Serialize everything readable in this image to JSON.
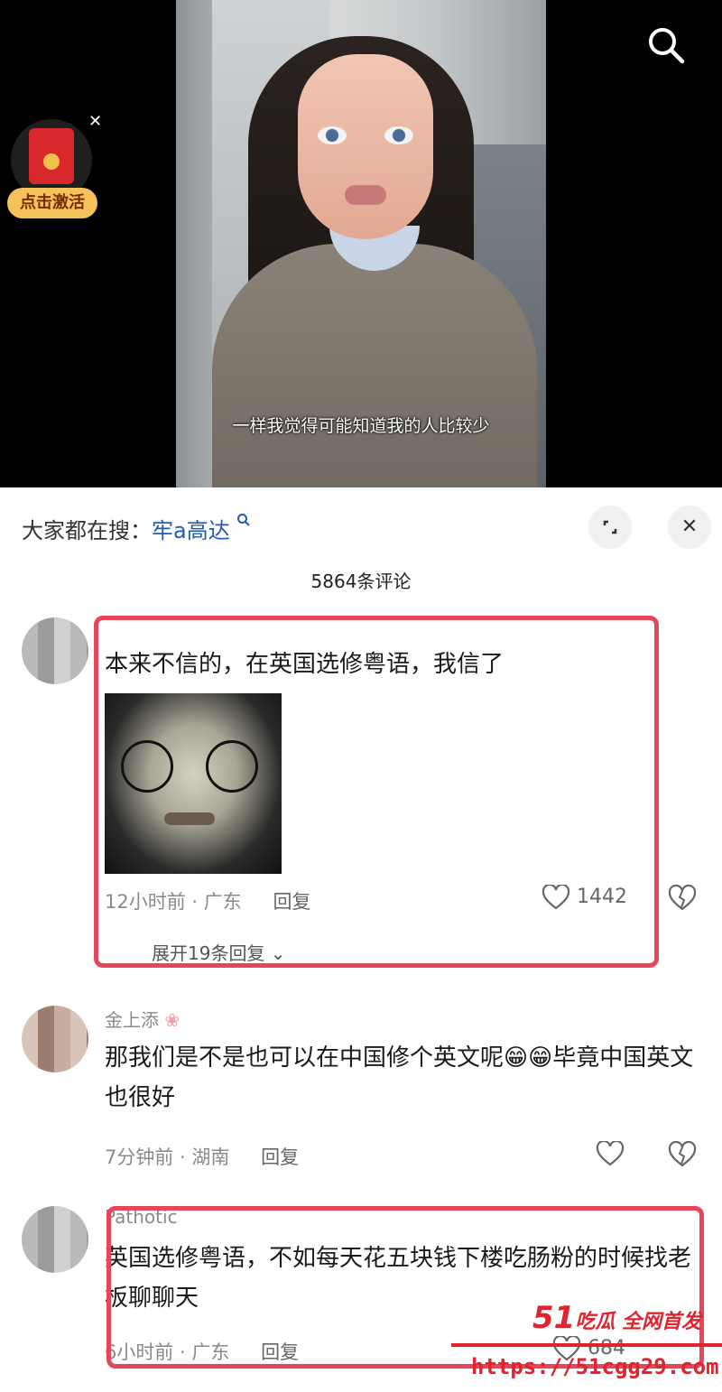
{
  "video": {
    "subtitle": "一样我觉得可能知道我的人比较少",
    "promo_button": "点击激活"
  },
  "panel": {
    "search_prefix": "大家都在搜：",
    "search_keyword": "牢a高达",
    "comment_count": "5864条评论"
  },
  "comments": [
    {
      "username": "",
      "text": "本来不信的，在英国选修粤语，我信了",
      "time": "12小时前",
      "location": "广东",
      "reply_label": "回复",
      "likes": "1442",
      "replies_link": "展开19条回复"
    },
    {
      "username": "金上添",
      "text": "那我们是不是也可以在中国修个英文呢😁😁毕竟中国英文也很好",
      "time": "7分钟前",
      "location": "湖南",
      "reply_label": "回复",
      "likes": ""
    },
    {
      "username": "Pathotic",
      "text": "英国选修粤语，不如每天花五块钱下楼吃肠粉的时候找老板聊聊天",
      "time": "6小时前",
      "location": "广东",
      "reply_label": "回复",
      "likes": "684"
    }
  ],
  "watermark": {
    "brand_num": "51",
    "brand_text": "吃瓜 全网首发",
    "url": "https://51cgg29.com"
  },
  "colors": {
    "highlight": "#e6465a",
    "keyword": "#1f5bb8",
    "watermark": "#e0232c"
  }
}
